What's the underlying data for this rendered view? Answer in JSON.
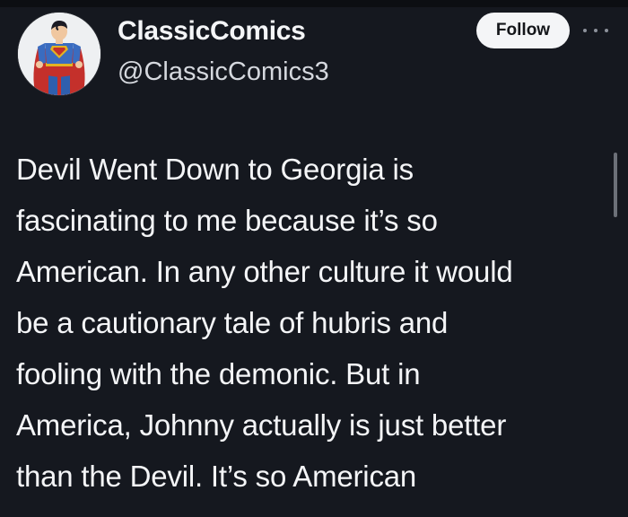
{
  "post": {
    "author": {
      "name": "ClassicComics",
      "handle": "@ClassicComics3",
      "avatar_icon": "superman-avatar-icon"
    },
    "follow_label": "Follow",
    "more_icon": "more-options-icon",
    "text_lines": [
      "Devil Went Down to Georgia is",
      "fascinating to me because it’s so",
      "American. In any other culture it would",
      "be a cautionary tale of hubris and",
      "fooling with the demonic. But in",
      "America, Johnny actually is just better",
      "than the Devil. It’s so American"
    ]
  },
  "theme": {
    "background": "#15181f",
    "text": "#f4f5f7",
    "secondary_text": "#d5d8de",
    "follow_bg": "#f4f5f7",
    "follow_text": "#14161a"
  }
}
